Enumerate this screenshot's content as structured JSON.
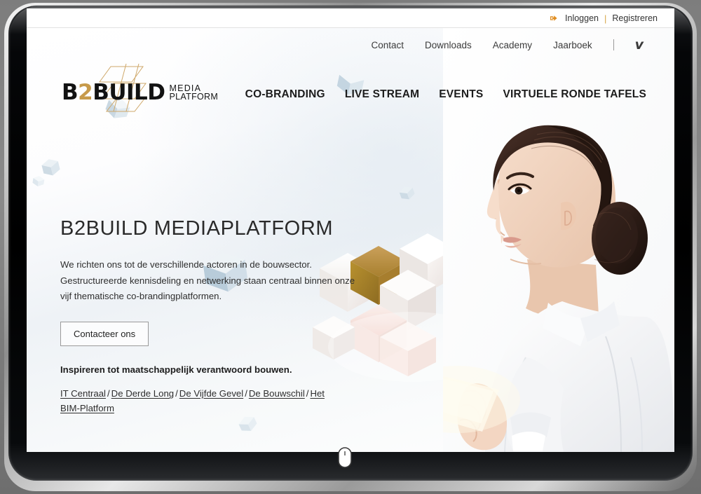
{
  "device": {
    "name": "tablet-device-frame"
  },
  "utility_bar": {
    "signin_icon": "signin-arrow-icon",
    "login_label": "Inloggen",
    "separator": "|",
    "register_label": "Registreren"
  },
  "header": {
    "top_nav": [
      {
        "label": "Contact",
        "name": "contact"
      },
      {
        "label": "Downloads",
        "name": "downloads"
      },
      {
        "label": "Academy",
        "name": "academy"
      },
      {
        "label": "Jaarboek",
        "name": "jaarboek"
      }
    ],
    "divider": "|",
    "vimeo_icon": "vimeo-icon",
    "vimeo_glyph": "v",
    "logo": {
      "mark_b": "B",
      "mark_two": "2",
      "mark_build": "BUILD",
      "sub_line1": "MEDIA",
      "sub_line2": "PLATFORM",
      "accent_color": "#c79a4a"
    },
    "main_nav": [
      {
        "label": "CO-BRANDING",
        "name": "co-branding"
      },
      {
        "label": "LIVE STREAM",
        "name": "live-stream"
      },
      {
        "label": "EVENTS",
        "name": "events"
      },
      {
        "label": "VIRTUELE RONDE TAFELS",
        "name": "virtuele-ronde-tafels"
      }
    ]
  },
  "hero": {
    "title": "B2BUILD MEDIAPLATFORM",
    "paragraph": "We richten ons tot de verschillende actoren in de bouwsector. Gestructureerde kennisdeling en netwerking staan centraal binnen onze vijf thematische co-brandingplatformen.",
    "cta_label": "Contacteer ons",
    "tagline": "Inspireren tot maatschappelijk verantwoord bouwen.",
    "platform_links": [
      {
        "label": "IT Centraal"
      },
      {
        "label": "De Derde Long"
      },
      {
        "label": "De Vijfde Gevel"
      },
      {
        "label": "De Bouwschil"
      },
      {
        "label": "Het BIM-Platform"
      }
    ],
    "separator": "/",
    "graphic": "3d-cube-cluster-graphic",
    "photo": "woman-with-tablet-photo"
  },
  "cursor": {
    "name": "mouse-pointer-cursor"
  },
  "colors": {
    "accent_gold": "#c79a4a",
    "cube_gold": "#b98b36",
    "cube_blue": "#b9cbd8",
    "text_dark": "#1d1d1d",
    "bezel": "#000000"
  }
}
